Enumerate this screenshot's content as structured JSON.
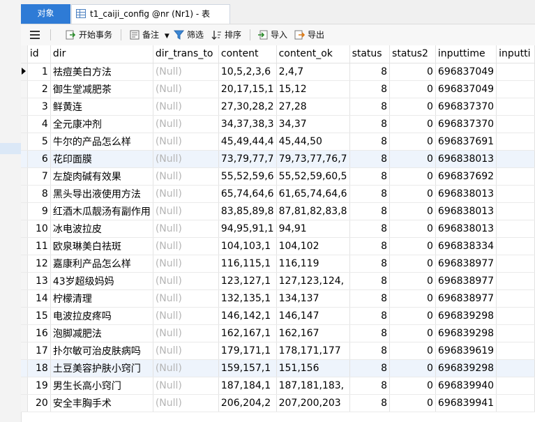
{
  "tabs": {
    "objects": "对象",
    "table": "t1_caiji_config @nr (Nr1) - 表"
  },
  "toolbar": {
    "begin_transaction": "开始事务",
    "memo": "备注",
    "filter": "筛选",
    "sort": "排序",
    "import": "导入",
    "export": "导出"
  },
  "columns": [
    "id",
    "dir",
    "dir_trans_to",
    "content",
    "content_ok",
    "status",
    "status2",
    "inputtime",
    "inputti"
  ],
  "rows": [
    {
      "id": "1",
      "dir": "祛痘美白方法",
      "dir_trans_to": "(Null)",
      "content": "10,5,2,3,6",
      "content_ok": "2,4,7",
      "status": "8",
      "status2": "0",
      "inputtime": "696837049",
      "inputti": ""
    },
    {
      "id": "2",
      "dir": "御生堂减肥茶",
      "dir_trans_to": "(Null)",
      "content": "20,17,15,1",
      "content_ok": "15,12",
      "status": "8",
      "status2": "0",
      "inputtime": "696837049",
      "inputti": ""
    },
    {
      "id": "3",
      "dir": "鲜黄连",
      "dir_trans_to": "(Null)",
      "content": "27,30,28,2",
      "content_ok": "27,28",
      "status": "8",
      "status2": "0",
      "inputtime": "696837370",
      "inputti": ""
    },
    {
      "id": "4",
      "dir": "全元康冲剂",
      "dir_trans_to": "(Null)",
      "content": "34,37,38,3",
      "content_ok": "34,37",
      "status": "8",
      "status2": "0",
      "inputtime": "696837370",
      "inputti": ""
    },
    {
      "id": "5",
      "dir": "牛尔的产品怎么样",
      "dir_trans_to": "(Null)",
      "content": "45,49,44,4",
      "content_ok": "45,44,50",
      "status": "8",
      "status2": "0",
      "inputtime": "696837691",
      "inputti": ""
    },
    {
      "id": "6",
      "dir": "花印面膜",
      "dir_trans_to": "(Null)",
      "content": "73,79,77,7",
      "content_ok": "79,73,77,76,7",
      "status": "8",
      "status2": "0",
      "inputtime": "696838013",
      "inputti": ""
    },
    {
      "id": "7",
      "dir": "左旋肉碱有效果",
      "dir_trans_to": "(Null)",
      "content": "55,52,59,6",
      "content_ok": "55,52,59,60,5",
      "status": "8",
      "status2": "0",
      "inputtime": "696837692",
      "inputti": ""
    },
    {
      "id": "8",
      "dir": "黑头导出液使用方法",
      "dir_trans_to": "(Null)",
      "content": "65,74,64,6",
      "content_ok": "61,65,74,64,6",
      "status": "8",
      "status2": "0",
      "inputtime": "696838013",
      "inputti": ""
    },
    {
      "id": "9",
      "dir": "红酒木瓜靓汤有副作用",
      "dir_trans_to": "(Null)",
      "content": "83,85,89,8",
      "content_ok": "87,81,82,83,8",
      "status": "8",
      "status2": "0",
      "inputtime": "696838013",
      "inputti": ""
    },
    {
      "id": "10",
      "dir": "冰电波拉皮",
      "dir_trans_to": "(Null)",
      "content": "94,95,91,1",
      "content_ok": "94,91",
      "status": "8",
      "status2": "0",
      "inputtime": "696838013",
      "inputti": ""
    },
    {
      "id": "11",
      "dir": "欧泉琳美白祛斑",
      "dir_trans_to": "(Null)",
      "content": "104,103,1",
      "content_ok": "104,102",
      "status": "8",
      "status2": "0",
      "inputtime": "696838334",
      "inputti": ""
    },
    {
      "id": "12",
      "dir": "嘉康利产品怎么样",
      "dir_trans_to": "(Null)",
      "content": "116,115,1",
      "content_ok": "116,119",
      "status": "8",
      "status2": "0",
      "inputtime": "696838977",
      "inputti": ""
    },
    {
      "id": "13",
      "dir": "43岁超级妈妈",
      "dir_trans_to": "(Null)",
      "content": "123,127,1",
      "content_ok": "127,123,124,",
      "status": "8",
      "status2": "0",
      "inputtime": "696838977",
      "inputti": ""
    },
    {
      "id": "14",
      "dir": "柠檬清理",
      "dir_trans_to": "(Null)",
      "content": "132,135,1",
      "content_ok": "134,137",
      "status": "8",
      "status2": "0",
      "inputtime": "696838977",
      "inputti": ""
    },
    {
      "id": "15",
      "dir": "电波拉皮疼吗",
      "dir_trans_to": "(Null)",
      "content": "146,142,1",
      "content_ok": "146,147",
      "status": "8",
      "status2": "0",
      "inputtime": "696839298",
      "inputti": ""
    },
    {
      "id": "16",
      "dir": "泡脚减肥法",
      "dir_trans_to": "(Null)",
      "content": "162,167,1",
      "content_ok": "162,167",
      "status": "8",
      "status2": "0",
      "inputtime": "696839298",
      "inputti": ""
    },
    {
      "id": "17",
      "dir": "扑尔敏可治皮肤病吗",
      "dir_trans_to": "(Null)",
      "content": "179,171,1",
      "content_ok": "178,171,177",
      "status": "8",
      "status2": "0",
      "inputtime": "696839619",
      "inputti": ""
    },
    {
      "id": "18",
      "dir": "土豆美容护肤小窍门",
      "dir_trans_to": "(Null)",
      "content": "159,157,1",
      "content_ok": "151,156",
      "status": "8",
      "status2": "0",
      "inputtime": "696839298",
      "inputti": ""
    },
    {
      "id": "19",
      "dir": "男生长高小窍门",
      "dir_trans_to": "(Null)",
      "content": "187,184,1",
      "content_ok": "187,181,183,",
      "status": "8",
      "status2": "0",
      "inputtime": "696839940",
      "inputti": ""
    },
    {
      "id": "20",
      "dir": "安全丰胸手术",
      "dir_trans_to": "(Null)",
      "content": "206,204,2",
      "content_ok": "207,200,203",
      "status": "8",
      "status2": "0",
      "inputtime": "696839941",
      "inputti": ""
    }
  ]
}
